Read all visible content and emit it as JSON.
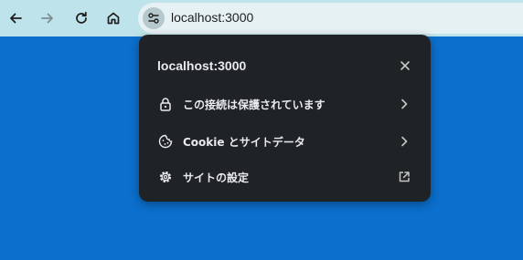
{
  "toolbar": {
    "back": "back-arrow-icon",
    "forward": "forward-arrow-icon",
    "reload": "reload-icon",
    "home": "home-icon"
  },
  "omnibox": {
    "site_info_icon": "tune-icon",
    "url": "localhost:3000"
  },
  "popup": {
    "title": "localhost:3000",
    "close_icon": "close-icon",
    "items": [
      {
        "icon": "lock-icon",
        "label": "この接続は保護されています",
        "end_icon": "chevron-right-icon"
      },
      {
        "icon": "cookie-icon",
        "label": "Cookie とサイトデータ",
        "end_icon": "chevron-right-icon"
      },
      {
        "icon": "gear-icon",
        "label": "サイトの設定",
        "end_icon": "open-in-new-icon"
      }
    ]
  },
  "colors": {
    "page_background": "#0b6fcd",
    "toolbar_background": "#bfe3ea",
    "omnibox_background": "#e6f1f4",
    "popup_background": "#1f2325",
    "popup_text": "#e8eaed"
  }
}
